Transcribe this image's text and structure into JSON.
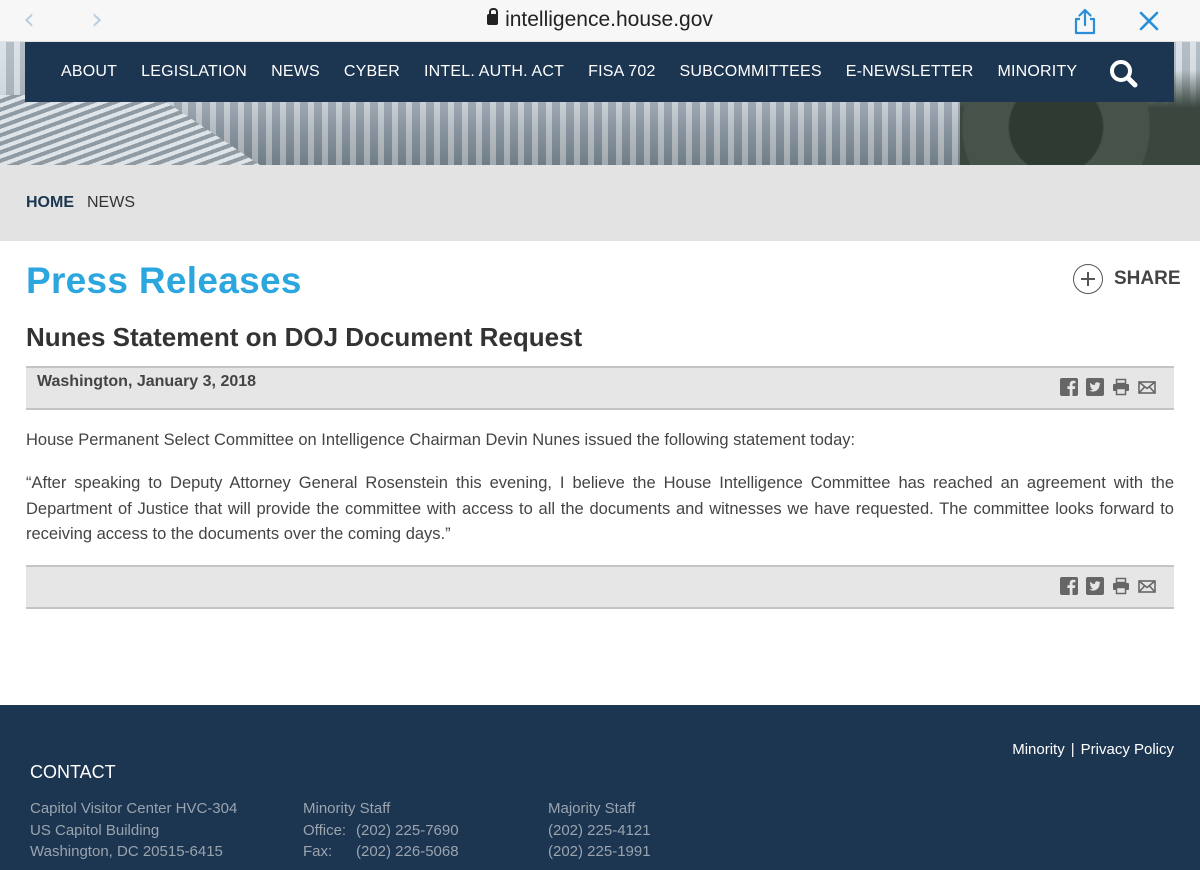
{
  "browser": {
    "back_glyph": "‹",
    "forward_glyph": "›",
    "url": "intelligence.house.gov"
  },
  "nav": {
    "items": [
      "ABOUT",
      "LEGISLATION",
      "NEWS",
      "CYBER",
      "INTEL. AUTH. ACT",
      "FISA 702",
      "SUBCOMMITTEES",
      "E-NEWSLETTER",
      "MINORITY"
    ]
  },
  "breadcrumb": {
    "home": "HOME",
    "current": "NEWS"
  },
  "page": {
    "section_title": "Press Releases",
    "share_label": "SHARE",
    "article_title": "Nunes Statement on DOJ Document Request",
    "dateline": "Washington, January 3, 2018",
    "intro": "House Permanent Select Committee on Intelligence Chairman Devin Nunes issued the following statement today:",
    "quote": "“After speaking to Deputy Attorney General Rosenstein this evening, I believe the House Intelligence Committee has reached an agreement with the Department of Justice that will provide the committee with access to all the documents and witnesses we have requested. The committee looks forward to receiving access to the documents over the coming days.”"
  },
  "footer": {
    "links": [
      "Minority",
      "Privacy Policy"
    ],
    "separator": "|",
    "contact_heading": "CONTACT",
    "address": [
      "Capitol Visitor Center HVC-304",
      "US Capitol Building",
      "Washington, DC 20515-6415"
    ],
    "minority": {
      "heading": "Minority Staff",
      "office_label": "Office:",
      "office": "(202) 225-7690",
      "fax_label": "Fax:",
      "fax": "(202) 226-5068"
    },
    "majority": {
      "heading": "Majority Staff",
      "office": "(202) 225-4121",
      "fax": "(202) 225-1991"
    }
  },
  "colors": {
    "navy": "#1c3550",
    "accent_blue": "#2ba6de",
    "browser_blue": "#2a8fd8"
  },
  "icons": [
    "lock-icon",
    "share-icon",
    "close-icon",
    "search-icon",
    "plus-icon",
    "facebook-icon",
    "twitter-icon",
    "print-icon",
    "email-icon"
  ]
}
